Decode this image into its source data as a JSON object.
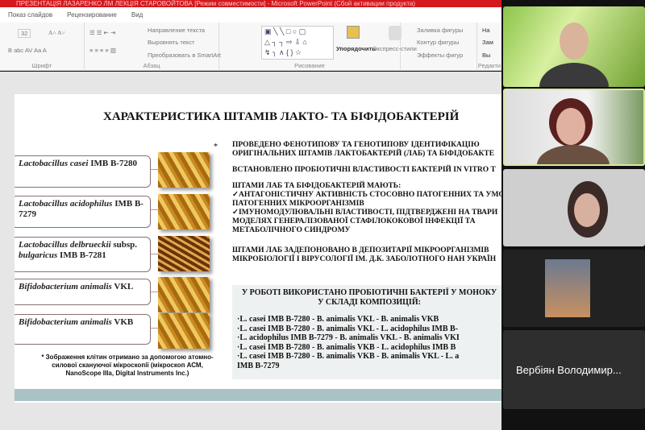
{
  "window": {
    "title": "ПРЕЗЕНТАЦІЯ ЛАЗАРЕНКО ЛМ ЛЕКЦІЯ СТАРОВОЙТОВА [Режим совместимости] - Microsoft PowerPoint (Сбой активации продукта)"
  },
  "menu": [
    "Показ слайдов",
    "Рецензирование",
    "Вид"
  ],
  "ribbon": {
    "font_size": "32",
    "font_group": "Шрифт",
    "paragraph_group": "Абзац",
    "drawing_group": "Рисование",
    "editing_group": "Редакти",
    "text_direction": "Направление текста",
    "align_text": "Выровнять текст",
    "smartart": "Преобразовать в SmartArt",
    "arrange": "Упорядочить",
    "quick_styles": "Экспресс-стили",
    "shape_fill": "Заливка фигуры",
    "shape_outline": "Контур фигуры",
    "shape_effects": "Эффекты фигур",
    "find": "На",
    "replace": "Зам",
    "select": "Вы"
  },
  "slide": {
    "title": "ХАРАКТЕРИСТИКА ШТАМІВ ЛАКТО- ТА БІФІДОБАКТЕРІЙ",
    "strains": [
      {
        "italic": "Lactobacillus casei",
        "rest": " IMB B-7280"
      },
      {
        "italic": "Lactobacillus acidophilus",
        "rest": " IMB B-7279"
      },
      {
        "italic": "Lactobacillus delbrueckii",
        "rest": " subsp. ",
        "italic2": "bulgaricus",
        "rest2": " IMB B-7281"
      },
      {
        "italic": "Bifidobacterium animalis",
        "rest": " VKL"
      },
      {
        "italic": "Bifidobacterium animalis",
        "rest": " VKB"
      }
    ],
    "star": "*",
    "caption": "* Зображення клітин отримано за допомогою атомно-силової скануючої мікроскопії (мікроскоп АСМ, NanoScope IIIa, Digital Instruments Inc.)",
    "paragraphs": [
      "ПРОВЕДЕНО ФЕНОТИПОВУ ТА ГЕНОТИПОВУ ІДЕНТИФІКАЦІЮ ОРИГІНАЛЬНИХ ШТАМІВ ЛАКТОБАКТЕРІЙ (ЛАБ) ТА БІФІДОБАКТЕ",
      "ВСТАНОВЛЕНО ПРОБІОТИЧНІ ВЛАСТИВОСТІ БАКТЕРІЙ IN VITRO Т",
      "ШТАМИ ЛАБ ТА БІФІДОБАКТЕРІЙ МАЮТЬ:",
      "✓АНТАГОНІСТИЧНУ АКТИВНІСТЬ СТОСОВНО ПАТОГЕННИХ ТА УМО ПАТОГЕННИХ МІКРООРГАНІЗМІВ",
      "✓ІМУНОМОДУЛЮВАЛЬНІ ВЛАСТИВОСТІ, ПІДТВЕРДЖЕНІ НА ТВАРИ МОДЕЛЯХ ГЕНЕРАЛІЗОВАНОЇ СТАФІЛОКОКОВОЇ ІНФЕКЦІЇ ТА МЕТАБОЛІЧНОГО СИНДРОМУ",
      "ШТАМИ ЛАБ ЗАДЕПОНОВАНО В ДЕПОЗИТАРІЇ МІКРООРГАНІЗМІВ МІКРОБІОЛОГІЇ І ВІРУСОЛОГІЇ ІМ. Д.К. ЗАБОЛОТНОГО НАН УКРАЇН"
    ],
    "composition_heading1": "У РОБОТІ ВИКОРИСТАНО ПРОБІОТИЧНІ БАКТЕРІЇ У МОНОКУ",
    "composition_heading2": "У СКЛАДІ КОМПОЗИЦІЙ:",
    "compositions": [
      "·L. casei IMB B-7280 - B. animalis VKL - B. animalis VKB",
      "·L. casei IMB B-7280 - B. animalis VKL - L. acidophilus IMB B-",
      "·L. acidophilus IMB B-7279 - B. animalis VKL - B. animalis VKI",
      "·L. casei IMB B-7280 - B. animalis VKB - L. acidophilus IMB B",
      "·L. casei IMB B-7280 - B. animalis VKB - B. animalis VKL - L. a",
      "IMB B-7279"
    ]
  },
  "participants": [
    {
      "name": "Вербіян Володимир..."
    }
  ]
}
